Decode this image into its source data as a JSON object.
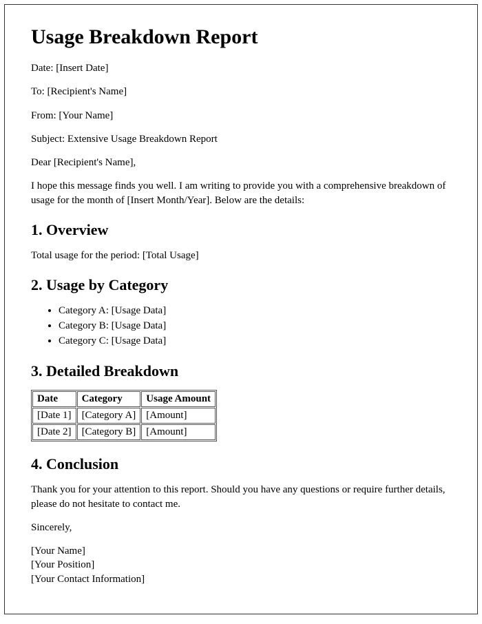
{
  "title": "Usage Breakdown Report",
  "meta": {
    "date": "Date: [Insert Date]",
    "to": "To: [Recipient's Name]",
    "from": "From: [Your Name]",
    "subject": "Subject: Extensive Usage Breakdown Report"
  },
  "salutation": "Dear [Recipient's Name],",
  "intro": "I hope this message finds you well. I am writing to provide you with a comprehensive breakdown of usage for the month of [Insert Month/Year]. Below are the details:",
  "sections": {
    "overview": {
      "heading": "1. Overview",
      "text": "Total usage for the period: [Total Usage]"
    },
    "byCategory": {
      "heading": "2. Usage by Category",
      "items": [
        "Category A: [Usage Data]",
        "Category B: [Usage Data]",
        "Category C: [Usage Data]"
      ]
    },
    "detailed": {
      "heading": "3. Detailed Breakdown",
      "headers": [
        "Date",
        "Category",
        "Usage Amount"
      ],
      "rows": [
        [
          "[Date 1]",
          "[Category A]",
          "[Amount]"
        ],
        [
          "[Date 2]",
          "[Category B]",
          "[Amount]"
        ]
      ]
    },
    "conclusion": {
      "heading": "4. Conclusion",
      "text": "Thank you for your attention to this report. Should you have any questions or require further details, please do not hesitate to contact me."
    }
  },
  "closing": "Sincerely,",
  "signature": {
    "name": "[Your Name]",
    "position": "[Your Position]",
    "contact": "[Your Contact Information]"
  }
}
